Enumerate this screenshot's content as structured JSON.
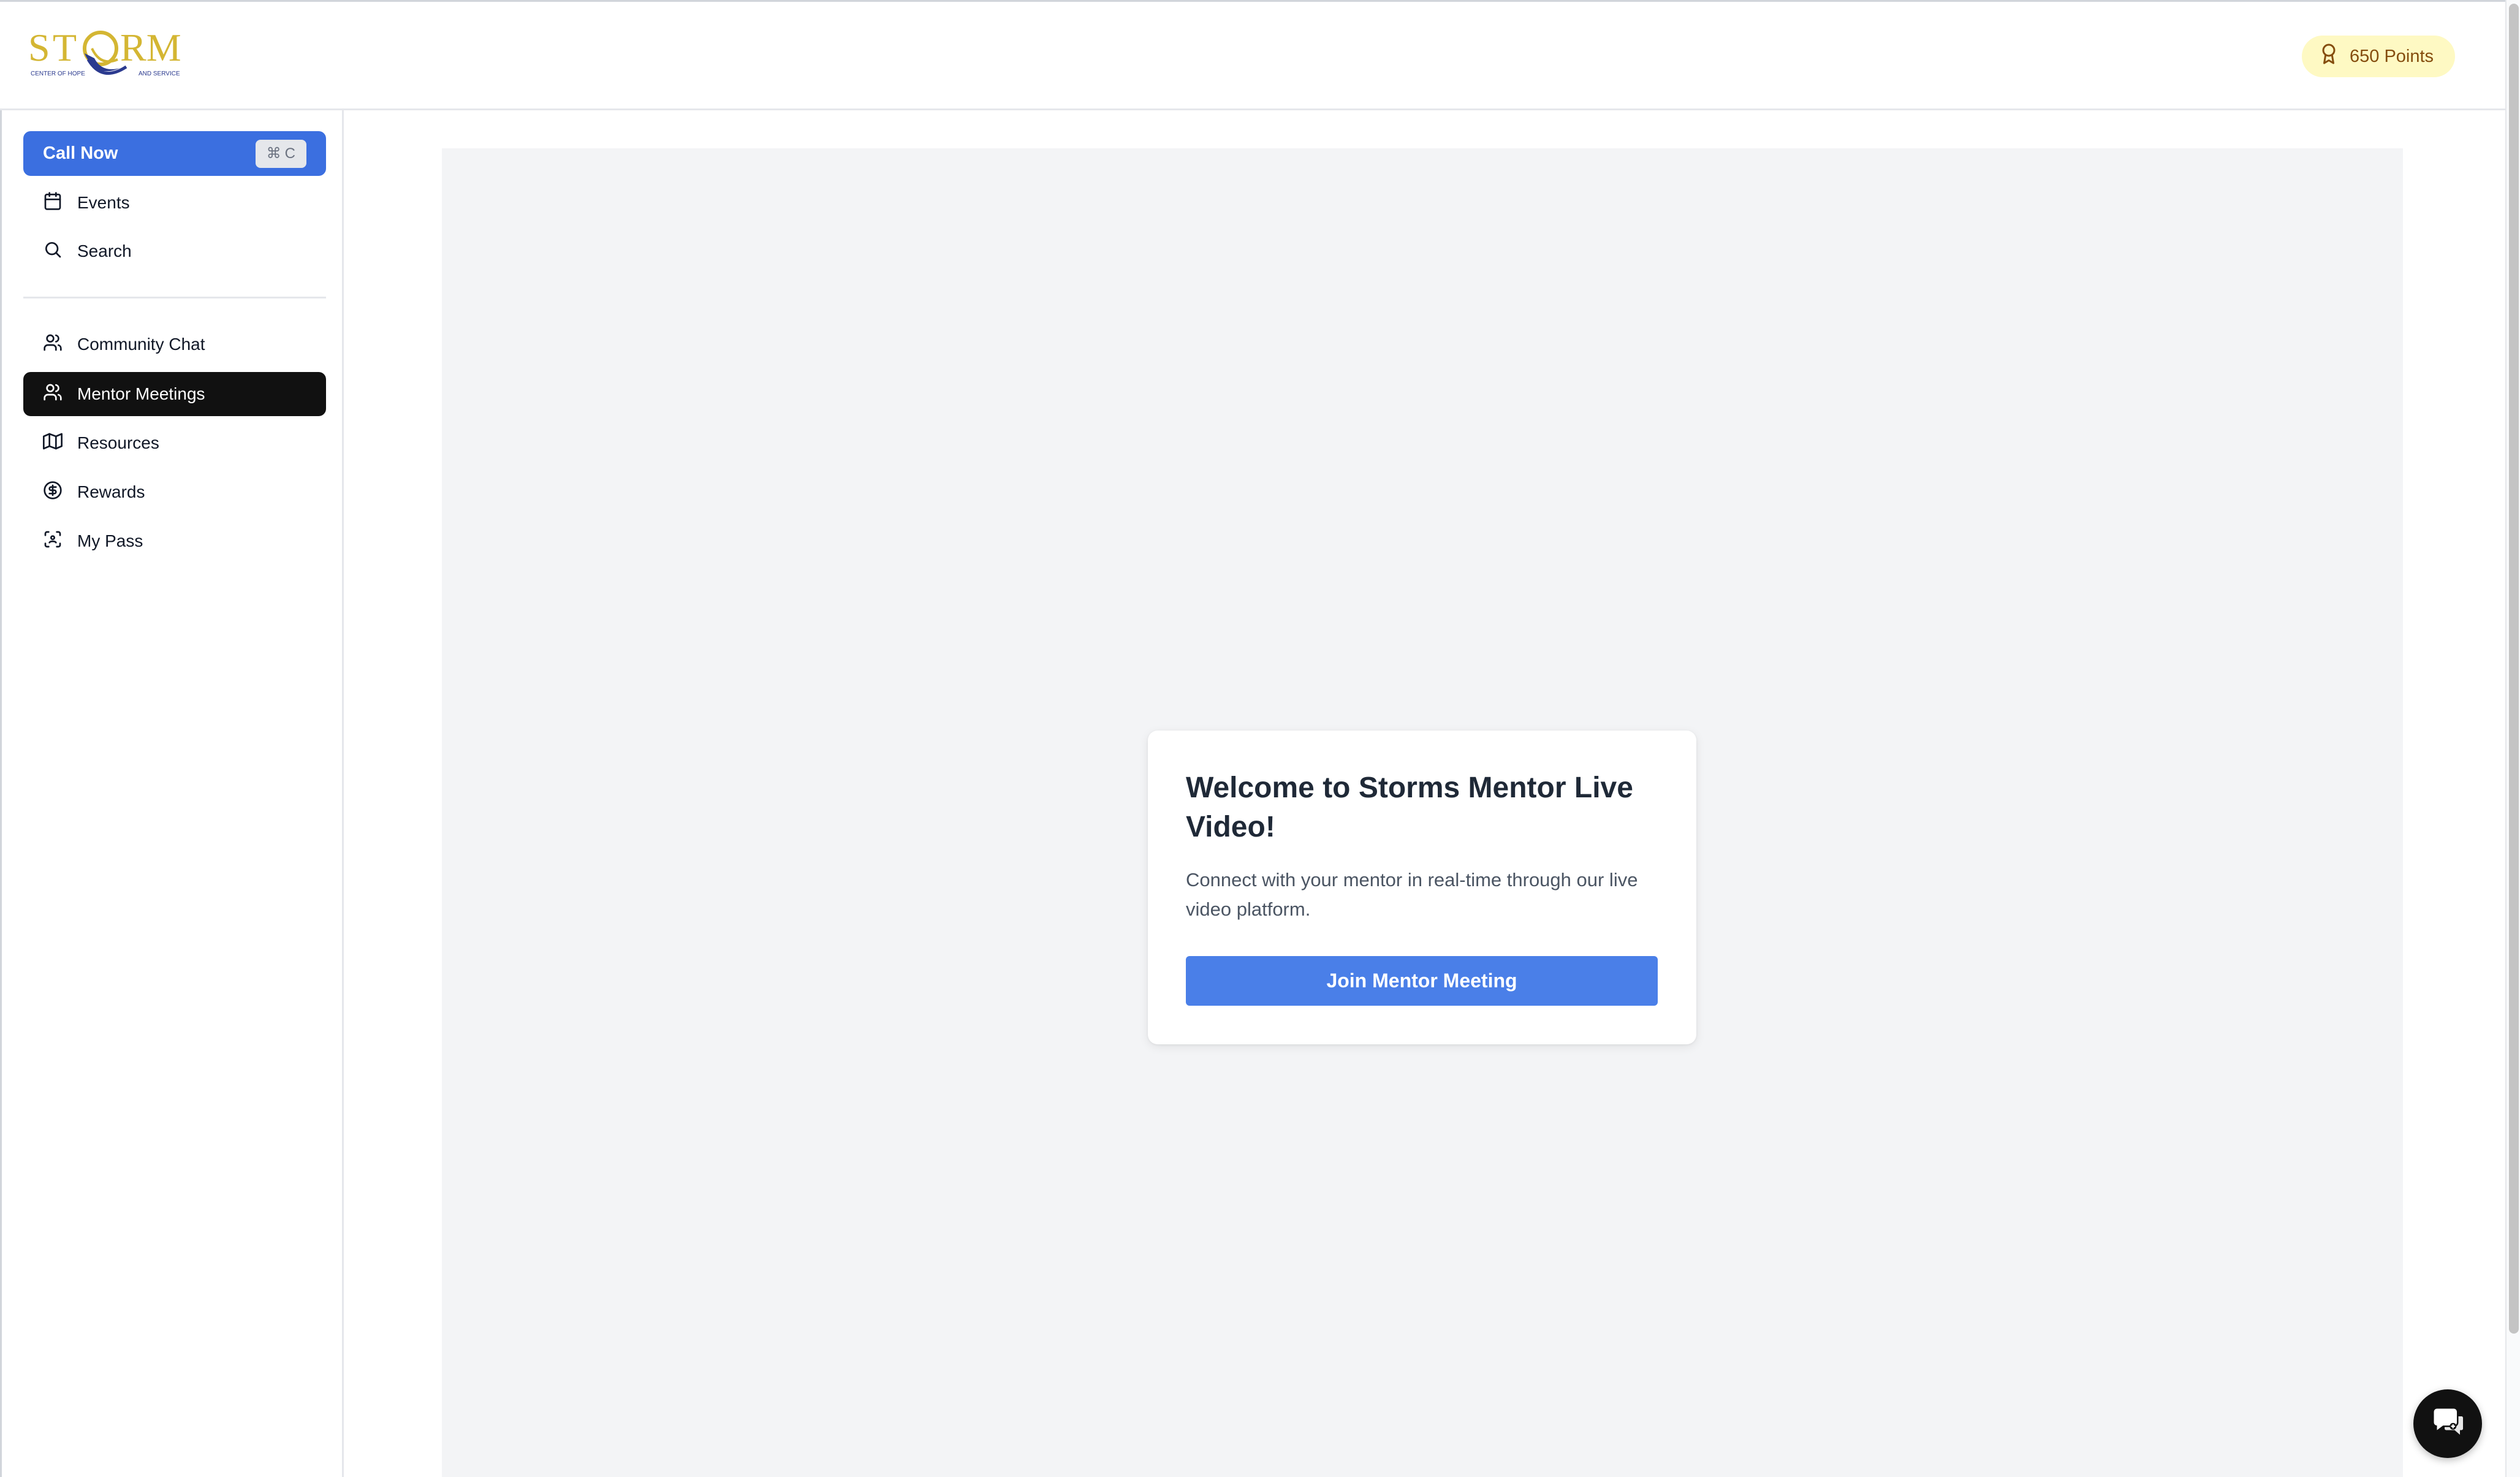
{
  "header": {
    "logo": {
      "name": "STORM",
      "tagline_left": "CENTER OF HOPE",
      "tagline_right": "AND SERVICE"
    },
    "points_label": "650 Points",
    "points_icon": "award-icon"
  },
  "sidebar": {
    "call_now": {
      "label": "Call Now",
      "shortcut_symbol": "⌘",
      "shortcut_key": "C"
    },
    "top_items": [
      {
        "label": "Events",
        "icon": "calendar-icon"
      },
      {
        "label": "Search",
        "icon": "search-icon"
      }
    ],
    "items": [
      {
        "label": "Community Chat",
        "icon": "users-icon"
      },
      {
        "label": "Mentor Meetings",
        "icon": "users-icon",
        "active": true
      },
      {
        "label": "Resources",
        "icon": "map-icon"
      },
      {
        "label": "Rewards",
        "icon": "dollar-circle-icon"
      },
      {
        "label": "My Pass",
        "icon": "scan-icon"
      }
    ]
  },
  "main": {
    "card": {
      "title": "Welcome to Storms Mentor Live Video!",
      "description": "Connect with your mentor in real-time through our live video platform.",
      "button_label": "Join Mentor Meeting"
    }
  },
  "colors": {
    "primary": "#3b6fe0",
    "button": "#4a7fe8",
    "active_nav": "#111111",
    "points_bg": "#fef9c3",
    "points_text": "#854d0e",
    "panel_bg": "#f3f4f6",
    "logo_gold": "#d4b633",
    "logo_navy": "#2b3a8f"
  },
  "floating": {
    "chat_icon": "chat-bubble-icon"
  }
}
